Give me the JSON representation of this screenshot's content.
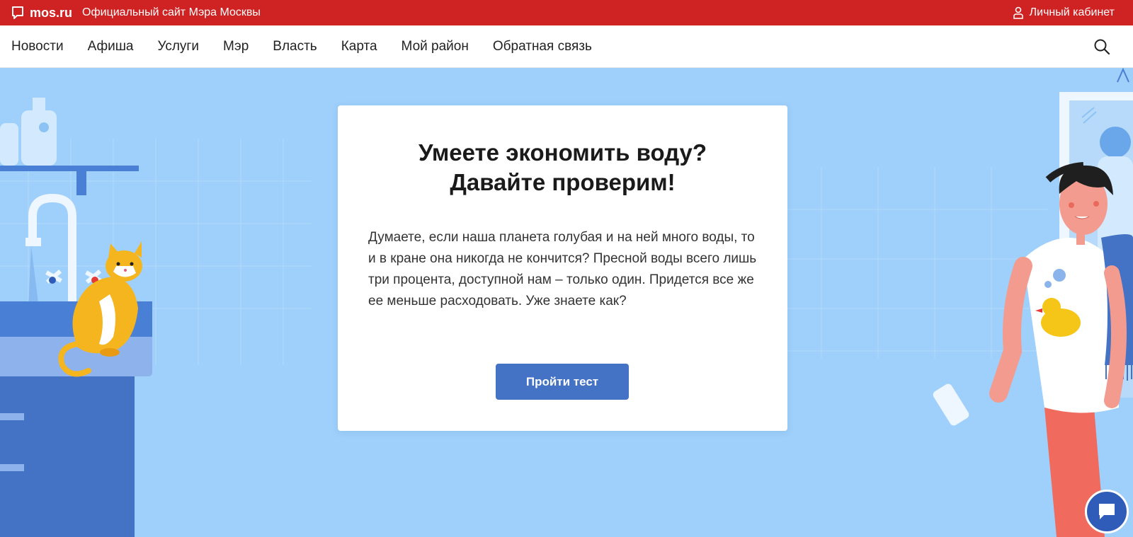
{
  "header": {
    "brand": "mos.ru",
    "subtitle": "Официальный сайт Мэра Москвы",
    "account_label": "Личный кабинет",
    "color": "#cf2222"
  },
  "nav": {
    "items": [
      {
        "label": "Новости"
      },
      {
        "label": "Афиша"
      },
      {
        "label": "Услуги"
      },
      {
        "label": "Мэр"
      },
      {
        "label": "Власть"
      },
      {
        "label": "Карта"
      },
      {
        "label": "Мой район"
      },
      {
        "label": "Обратная связь"
      }
    ],
    "search_icon": "search-icon"
  },
  "card": {
    "title_line1": "Умеете экономить воду?",
    "title_line2": "Давайте проверим!",
    "text": "Думаете, если наша планета голубая и на ней много воды, то и в кране она никогда не кончится? Пресной воды всего лишь три процента, доступной нам – только один. Придется все же ее меньше расходовать. Уже знаете как?",
    "button_label": "Пройти тест"
  },
  "colors": {
    "background": "#9fd0fb",
    "button": "#4472c4",
    "chat": "#2e5cb8"
  },
  "chat_icon": "chat-icon"
}
